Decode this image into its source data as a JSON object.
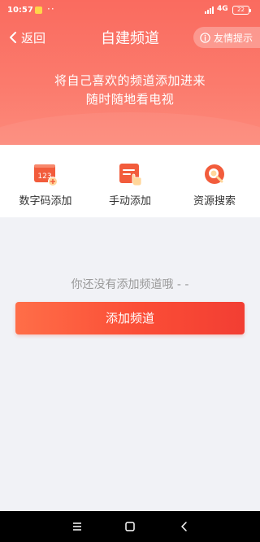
{
  "status_bar": {
    "time": "10:57",
    "network": "4G",
    "battery": "22"
  },
  "nav": {
    "back_label": "返回",
    "title": "自建频道",
    "tips_label": "友情提示"
  },
  "banner": {
    "line1": "将自己喜欢的频道添加进来",
    "line2": "随时随地看电视"
  },
  "options": [
    {
      "label": "数字码添加",
      "icon": "number-code-icon",
      "icon_text": "123"
    },
    {
      "label": "手动添加",
      "icon": "manual-add-icon"
    },
    {
      "label": "资源搜索",
      "icon": "resource-search-icon"
    }
  ],
  "empty_state": {
    "message": "你还没有添加频道哦 - -",
    "button_label": "添加频道"
  },
  "colors": {
    "header_gradient_start": "#fa6b5f",
    "header_gradient_end": "#fc8a7b",
    "accent": "#f5523c",
    "page_background": "#f1f2f6"
  }
}
